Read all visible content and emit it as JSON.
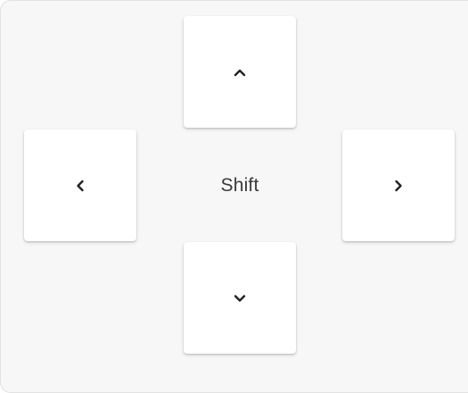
{
  "controls": {
    "center_label": "Shift",
    "buttons": [
      {
        "id": "up",
        "icon": "chevron-up-icon"
      },
      {
        "id": "left",
        "icon": "chevron-left-icon"
      },
      {
        "id": "right",
        "icon": "chevron-right-icon"
      },
      {
        "id": "down",
        "icon": "chevron-down-icon"
      }
    ]
  },
  "colors": {
    "panel_background": "#f7f7f7",
    "key_background": "#ffffff",
    "icon": "#222222",
    "label_text": "#3a3a3a"
  }
}
